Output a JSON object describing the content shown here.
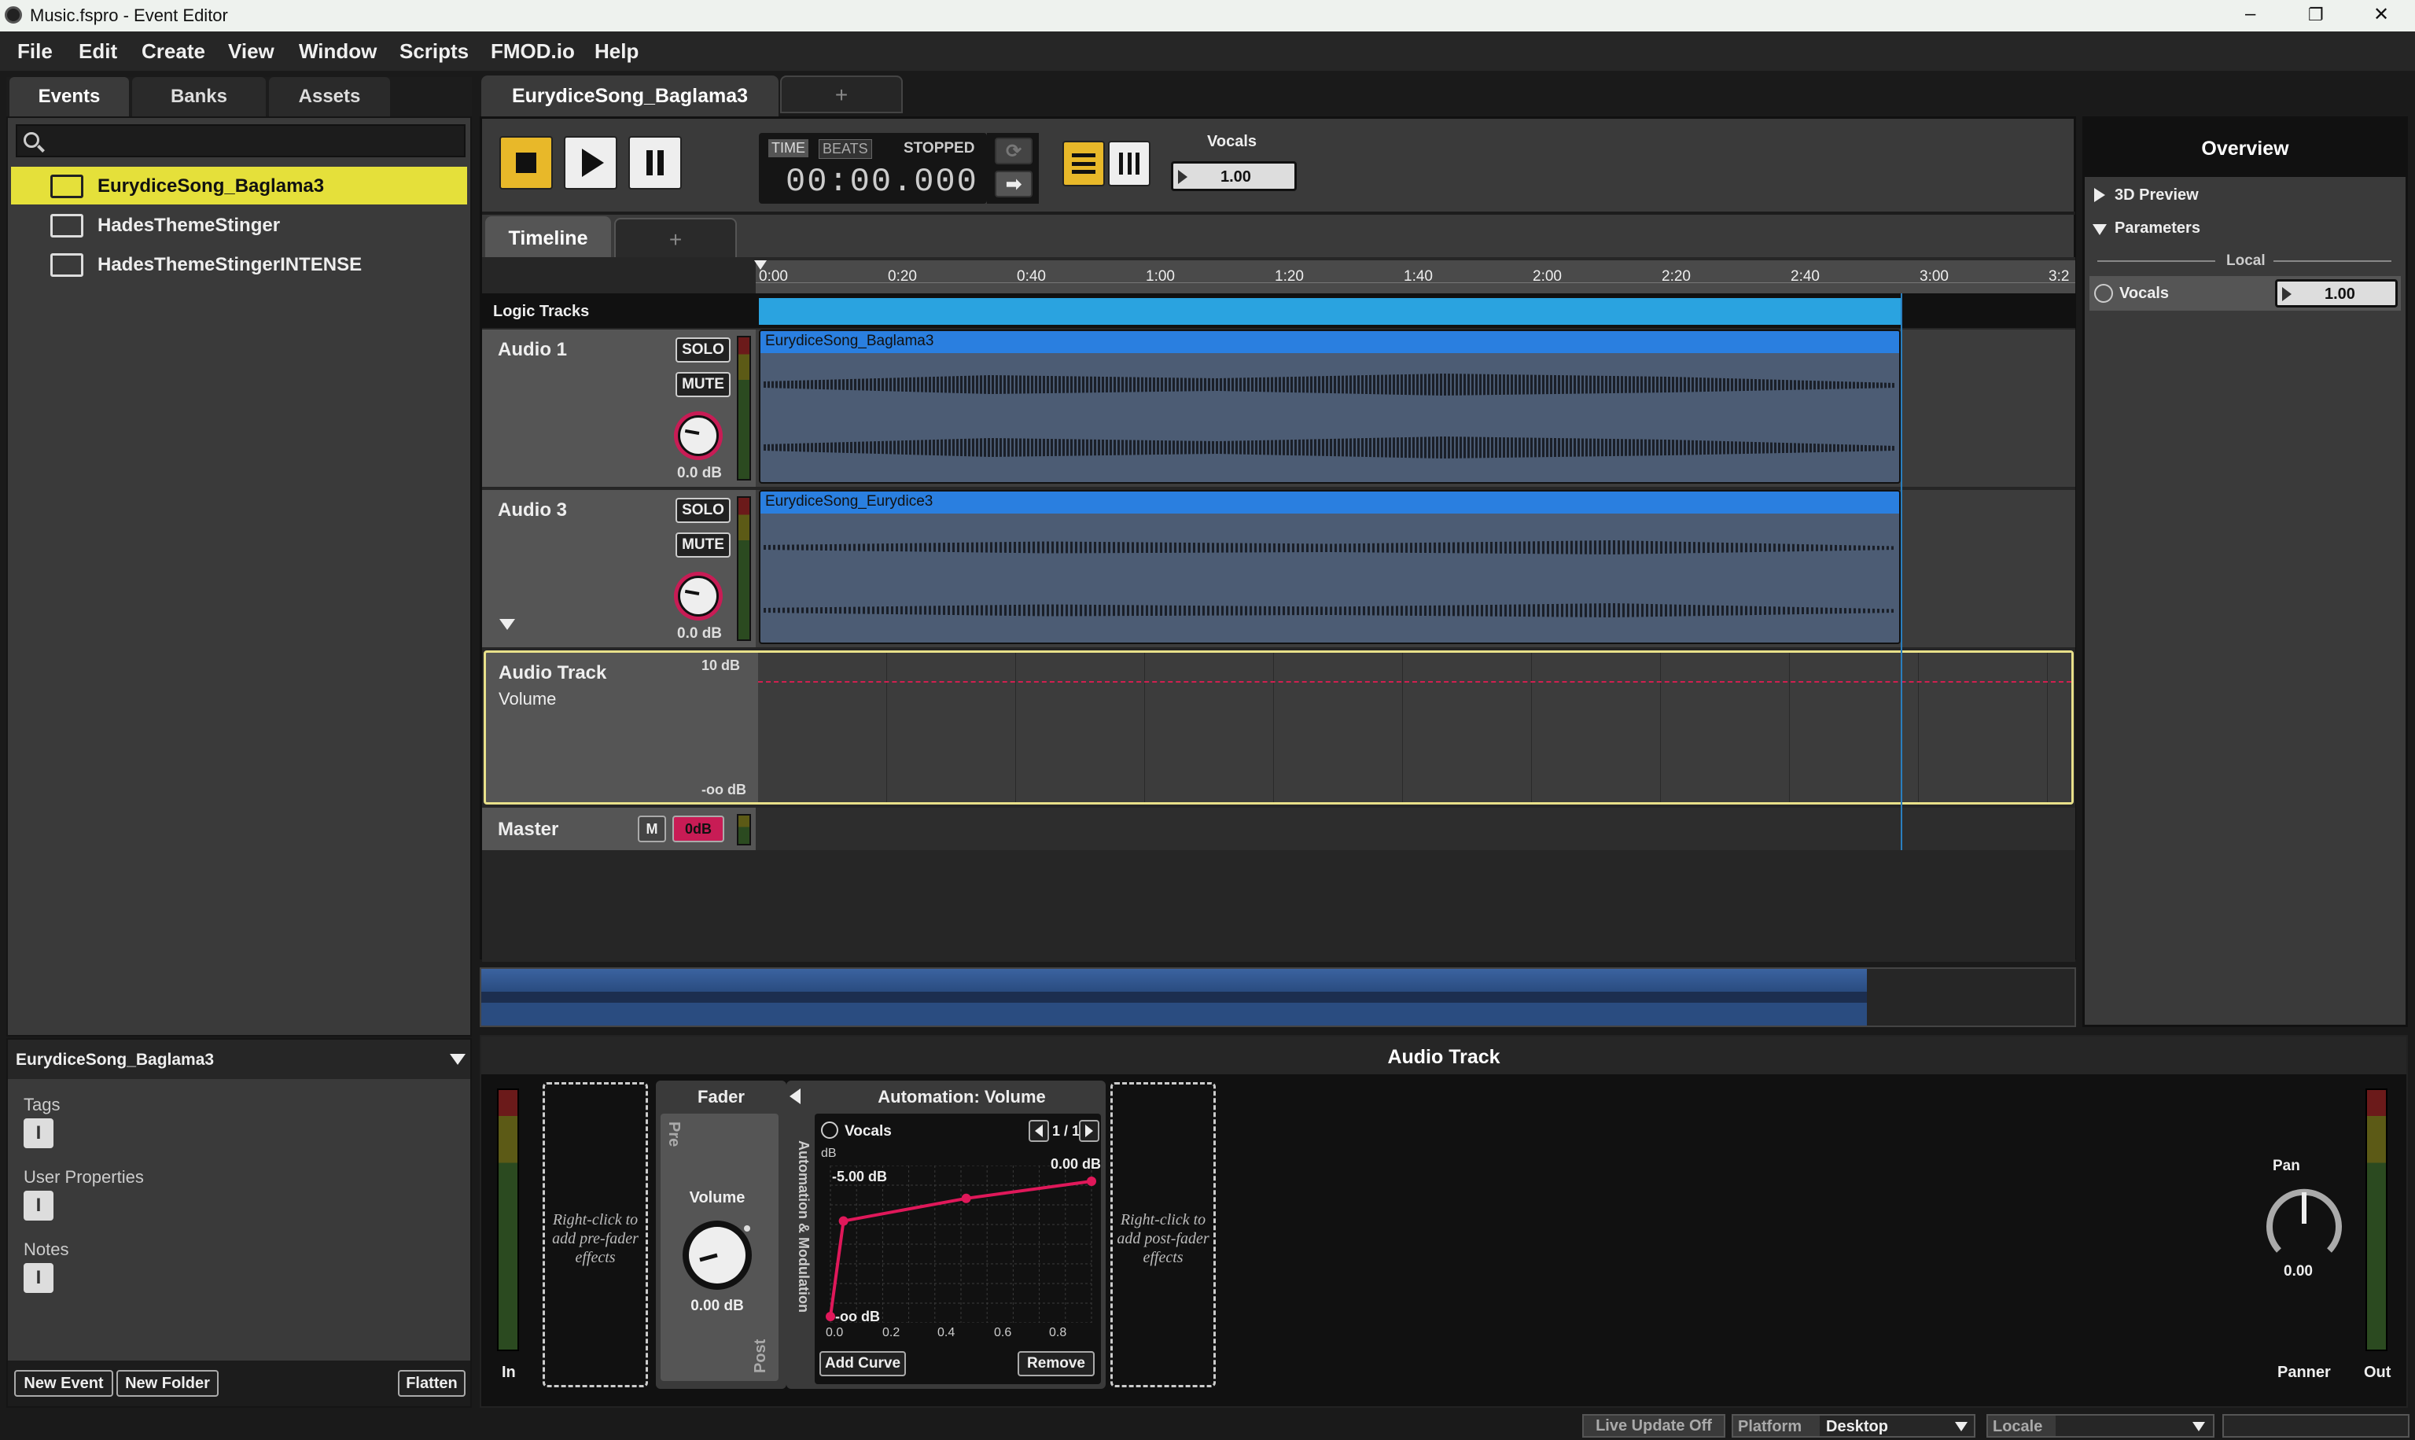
{
  "window": {
    "title": "Music.fspro - Event Editor",
    "controls": {
      "minimize": "–",
      "maximize": "❐",
      "close": "✕"
    }
  },
  "menu": [
    "File",
    "Edit",
    "Create",
    "View",
    "Window",
    "Scripts",
    "FMOD.io",
    "Help"
  ],
  "browser": {
    "tabs": [
      "Events",
      "Banks",
      "Assets"
    ],
    "events": [
      "EurydiceSong_Baglama3",
      "HadesThemeStinger",
      "HadesThemeStingerINTENSE"
    ],
    "selected": "EurydiceSong_Baglama3"
  },
  "properties": {
    "title": "EurydiceSong_Baglama3",
    "sections": [
      "Tags",
      "User Properties",
      "Notes"
    ],
    "buttons": {
      "new_event": "New Event",
      "new_folder": "New Folder",
      "flatten": "Flatten"
    }
  },
  "editor": {
    "event_tab": "EurydiceSong_Baglama3",
    "add_tab": "+",
    "transport": {
      "time_label": "TIME",
      "beats_label": "BEATS",
      "state": "STOPPED",
      "time": "00:00.000"
    },
    "vocals": {
      "label": "Vocals",
      "value": "1.00"
    },
    "timeline_tab": "Timeline",
    "ruler": [
      "0:00",
      "0:20",
      "0:40",
      "1:00",
      "1:20",
      "1:40",
      "2:00",
      "2:20",
      "2:40",
      "3:00",
      "3:2"
    ],
    "logic_tracks": "Logic Tracks",
    "tracks": [
      {
        "name": "Audio 1",
        "solo": "SOLO",
        "mute": "MUTE",
        "db": "0.0 dB",
        "clip": "EurydiceSong_Baglama3"
      },
      {
        "name": "Audio 3",
        "solo": "SOLO",
        "mute": "MUTE",
        "db": "0.0 dB",
        "clip": "EurydiceSong_Eurydice3"
      }
    ],
    "automation_lane": {
      "track": "Audio Track",
      "param": "Volume",
      "top": "10 dB",
      "bottom": "-oo dB"
    },
    "master": {
      "name": "Master",
      "m": "M",
      "db": "0dB"
    }
  },
  "overview": {
    "title": "Overview",
    "preview": "3D Preview",
    "parameters": "Parameters",
    "local": "Local",
    "param_name": "Vocals",
    "param_value": "1.00"
  },
  "deck": {
    "title": "Audio Track",
    "in": "In",
    "out": "Out",
    "pre_effects": "Right-click to add pre-fader effects",
    "post_effects": "Right-click to add post-fader effects",
    "fader": {
      "title": "Fader",
      "pre": "Pre",
      "post": "Post",
      "volume": "Volume",
      "value": "0.00 dB"
    },
    "side_label": "Automation & Modulation",
    "automation": {
      "title": "Automation: Volume",
      "param": "Vocals",
      "page": "1 / 1",
      "unit": "dB",
      "y_top": "-5.00 dB",
      "y_right": "0.00 dB",
      "y_bottom": "-oo dB",
      "x_ticks": [
        "0.0",
        "0.2",
        "0.4",
        "0.6",
        "0.8"
      ],
      "add_curve": "Add Curve",
      "remove": "Remove"
    },
    "panner": {
      "pan": "Pan",
      "value": "0.00",
      "label": "Panner"
    }
  },
  "statusbar": {
    "live_update": "Live Update Off",
    "platform_label": "Platform",
    "platform_value": "Desktop",
    "locale_label": "Locale"
  },
  "chart_data": {
    "type": "line",
    "series": [
      {
        "x": [
          0.0,
          0.05,
          0.52,
          1.0
        ],
        "y": [
          -60,
          -5,
          -2,
          0
        ]
      }
    ]
  }
}
